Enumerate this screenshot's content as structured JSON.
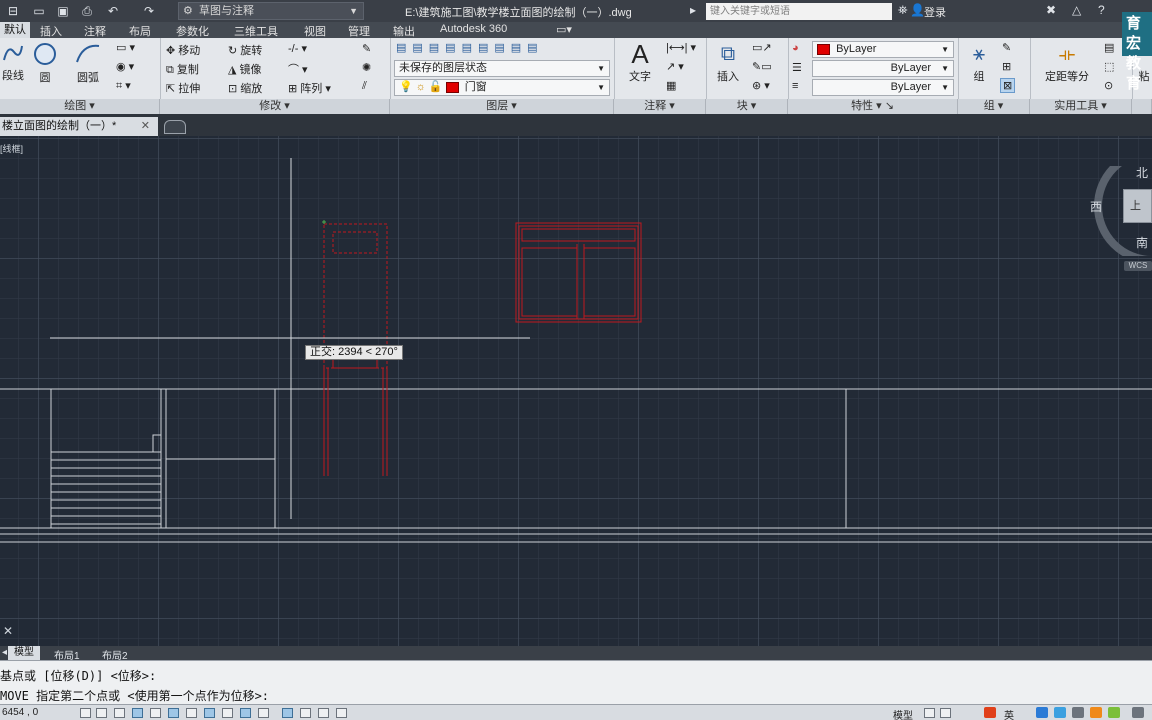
{
  "titlebar": {
    "workspace": "草图与注释",
    "document_path": "E:\\建筑施工图\\教学楼立面图的绘制（一）.dwg",
    "search_placeholder": "键入关键字或短语",
    "login": "登录"
  },
  "menu_tabs": [
    "默认",
    "插入",
    "注释",
    "布局",
    "参数化",
    "三维工具",
    "视图",
    "管理",
    "输出",
    "Autodesk 360"
  ],
  "ribbon": {
    "draw": {
      "label": "绘图",
      "polyline": "段线",
      "circle": "圆",
      "arc": "圆弧"
    },
    "modify": {
      "label": "修改",
      "move": "移动",
      "rotate": "旋转",
      "copy": "复制",
      "mirror": "镜像",
      "stretch": "拉伸",
      "scale": "缩放",
      "array": "阵列"
    },
    "layers": {
      "label": "图层",
      "layer_state": "未保存的图层状态",
      "current_layer": "门窗"
    },
    "annotation": {
      "label": "注释",
      "text": "文字"
    },
    "block": {
      "label": "块",
      "insert": "插入"
    },
    "properties": {
      "label": "特性",
      "color": "ByLayer",
      "linetype": "ByLayer",
      "lineweight": "ByLayer"
    },
    "groups": {
      "label": "组",
      "group": "组"
    },
    "utilities": {
      "label": "实用工具",
      "measure": "定距等分"
    },
    "clipboard": {
      "paste": "粘"
    }
  },
  "document_tab": {
    "title": "楼立面图的绘制（一）*"
  },
  "canvas": {
    "view_label": "[线框]",
    "tooltip": "正交: 2394 < 270°",
    "viewcube": {
      "north": "北",
      "south": "南",
      "west": "西",
      "face": "上",
      "wcs": "WCS"
    },
    "colors": {
      "background": "#222a36",
      "white_lines": "#cfd3d8",
      "red_lines": "#c0181e"
    }
  },
  "layout_tabs": [
    "模型",
    "布局1",
    "布局2"
  ],
  "command_line": {
    "line1": "基点或 [位移(D)] <位移>:",
    "line2": "MOVE 指定第二个点或 <使用第一个点作为位移>:"
  },
  "statusbar": {
    "coords": "6454 , 0",
    "model": "模型",
    "ime": "英"
  },
  "logo": {
    "text1": "育宏",
    "text2": "教育"
  }
}
